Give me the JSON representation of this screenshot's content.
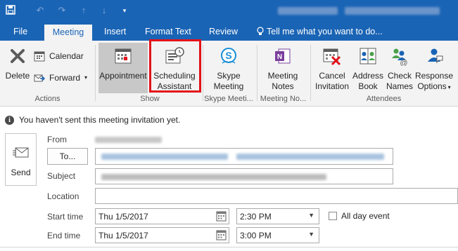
{
  "window": {
    "title": ""
  },
  "qat": {
    "icons": [
      "save-icon",
      "undo-icon",
      "redo-icon",
      "up-arrow-icon",
      "down-arrow-icon",
      "customize-icon"
    ]
  },
  "tabs": [
    {
      "label": "File",
      "active": false
    },
    {
      "label": "Meeting",
      "active": true
    },
    {
      "label": "Insert",
      "active": false
    },
    {
      "label": "Format Text",
      "active": false
    },
    {
      "label": "Review",
      "active": false
    }
  ],
  "tell_me": "Tell me what you want to do...",
  "ribbon": {
    "actions": {
      "delete": "Delete",
      "calendar": "Calendar",
      "forward": "Forward",
      "group": "Actions"
    },
    "show": {
      "appointment": "Appointment",
      "scheduling_line1": "Scheduling",
      "scheduling_line2": "Assistant",
      "group": "Show"
    },
    "skype": {
      "line1": "Skype",
      "line2": "Meeting",
      "group": "Skype Meeti..."
    },
    "notes": {
      "line1": "Meeting",
      "line2": "Notes",
      "group": "Meeting No..."
    },
    "attendees": {
      "cancel1": "Cancel",
      "cancel2": "Invitation",
      "address1": "Address",
      "address2": "Book",
      "check1": "Check",
      "check2": "Names",
      "response1": "Response",
      "response2": "Options",
      "group": "Attendees"
    }
  },
  "info_bar": "You haven't sent this meeting invitation yet.",
  "form": {
    "send": "Send",
    "from_label": "From",
    "to_button": "To...",
    "subject_label": "Subject",
    "location_label": "Location",
    "start_label": "Start time",
    "end_label": "End time",
    "start_date": "Thu 1/5/2017",
    "start_time": "2:30 PM",
    "end_date": "Thu 1/5/2017",
    "end_time": "3:00 PM",
    "all_day": "All day event",
    "all_day_checked": false,
    "location_value": ""
  },
  "colors": {
    "accent": "#1a64b5",
    "highlight": "#e3121a",
    "ribbon_bg": "#f3f3f3"
  }
}
